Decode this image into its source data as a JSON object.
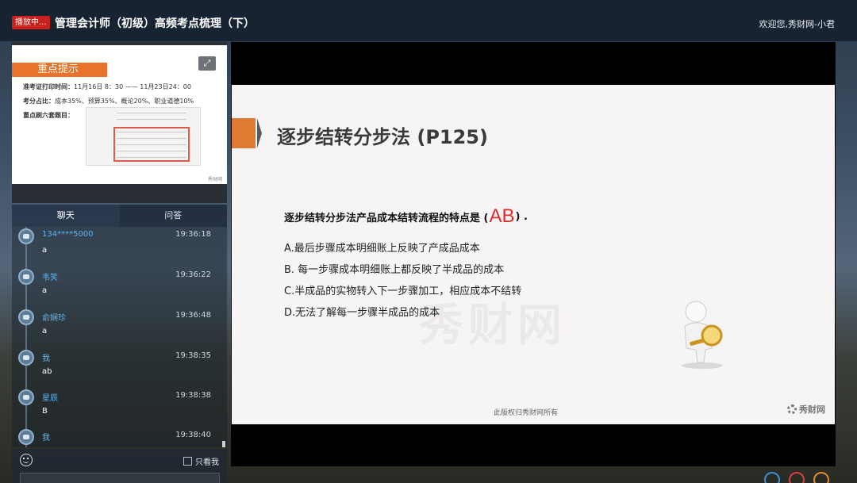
{
  "header": {
    "live_badge": "播放中...",
    "course_title": "管理会计师（初级）高频考点梳理（下）",
    "welcome": "欢迎您,秀财网-小君"
  },
  "preview": {
    "banner": "重点提示",
    "line1_label": "准考证打印时间：",
    "line1_value": "11月16日 8：30 —— 11月23日24：00",
    "line2_label": "考分占比：",
    "line2_value": "成本35%、预算35%、概论20%、职业道德10%",
    "line3_label": "重点刷六套题目："
  },
  "tabs": [
    {
      "label": "聊天",
      "active": true
    },
    {
      "label": "问答",
      "active": false
    }
  ],
  "chat": {
    "messages": [
      {
        "name": "134****5000",
        "time": "19:36:18",
        "text": "a"
      },
      {
        "name": "韦笑",
        "time": "19:36:22",
        "text": "a"
      },
      {
        "name": "俞娴珍",
        "time": "19:36:48",
        "text": "a"
      },
      {
        "name": "我",
        "time": "19:38:35",
        "text": "ab"
      },
      {
        "name": "星辰",
        "time": "19:38:38",
        "text": "B"
      },
      {
        "name": "我",
        "time": "19:38:40",
        "text": ""
      }
    ],
    "only_me_label": "只看我"
  },
  "slide": {
    "title": "逐步结转分步法 (P125)",
    "question_prefix": "逐步结转分步法产品成本结转流程的特点是 (",
    "answer": "AB",
    "question_suffix": ") .",
    "options": [
      "A.最后步骤成本明细账上反映了产成品成本",
      "B. 每一步骤成本明细账上都反映了半成品的成本",
      "C.半成品的实物转入下一步骤加工，相应成本不结转",
      "D.无法了解每一步骤半成品的成本"
    ],
    "watermark": "秀财网",
    "copyright": "此版权归秀财网所有",
    "brand": "秀财网"
  },
  "colors": {
    "accent_orange": "#e07a33",
    "answer_red": "#e02b2b",
    "live_red": "#c9211e",
    "username_blue": "#5fb4f0"
  }
}
